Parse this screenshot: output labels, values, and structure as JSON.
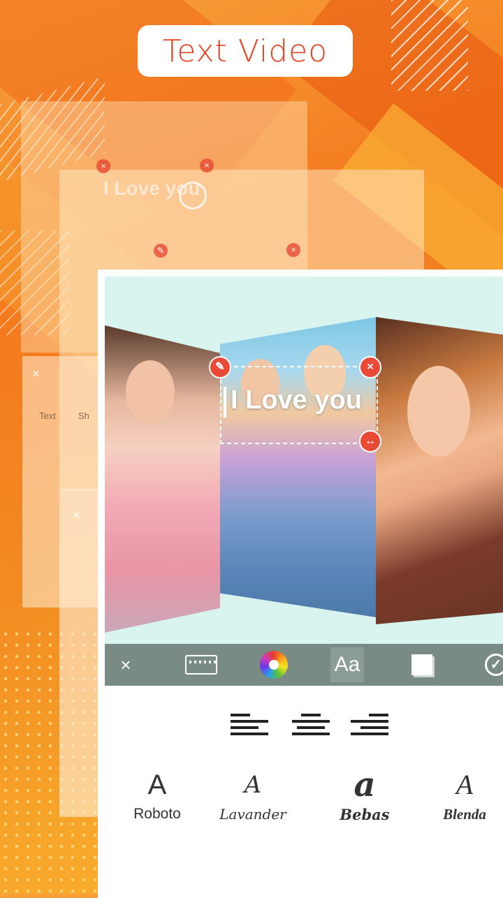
{
  "header": {
    "title": "Text Video"
  },
  "background": {
    "ghost_tab_text": "Text",
    "ghost_tab_text2": "Sh",
    "ghost_overlay_text": "I Love you"
  },
  "canvas": {
    "overlay_text": "I Love you"
  },
  "toolbar": {
    "close_glyph": "×",
    "font_label": "Aa",
    "done_glyph": "✓",
    "icons": [
      "close-icon",
      "keyboard-icon",
      "color-wheel-icon",
      "font-icon",
      "background-icon",
      "check-icon"
    ]
  },
  "fonts": [
    {
      "glyph": "A",
      "name": "Roboto"
    },
    {
      "glyph": "A",
      "name": "Lavander"
    },
    {
      "glyph": "a",
      "name": "Bebas"
    },
    {
      "glyph": "A",
      "name": "Blenda"
    }
  ],
  "colors": {
    "accent": "#e8401f",
    "toolbar": "#7a8a84",
    "handle": "#e84a35"
  }
}
